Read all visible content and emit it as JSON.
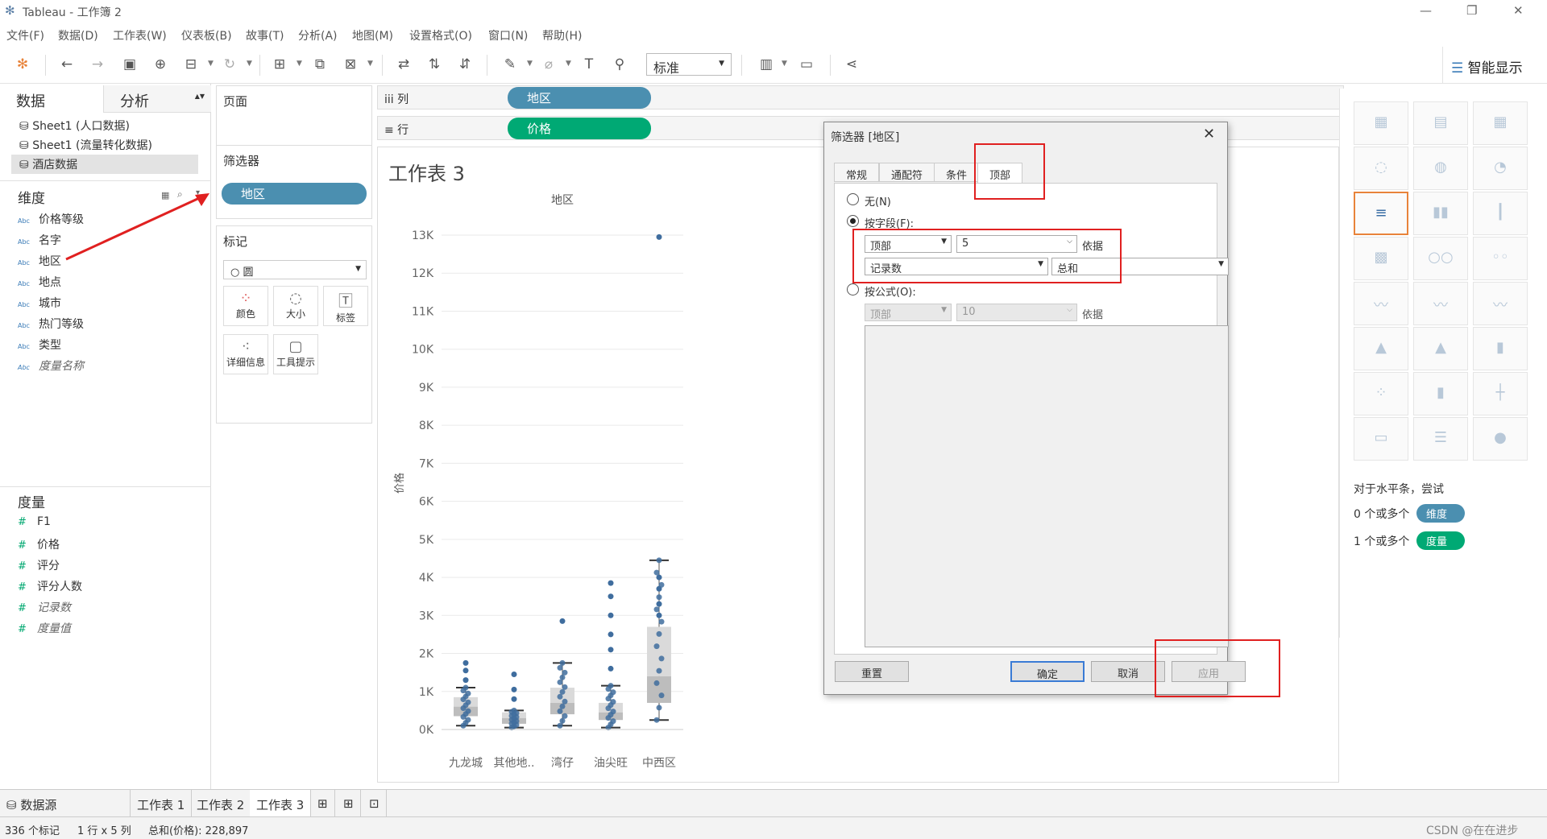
{
  "window": {
    "title": "Tableau - 工作簿 2",
    "controls": [
      "—",
      "❐",
      "✕"
    ]
  },
  "menu": [
    "文件(F)",
    "数据(D)",
    "工作表(W)",
    "仪表板(B)",
    "故事(T)",
    "分析(A)",
    "地图(M)",
    "设置格式(O)",
    "窗口(N)",
    "帮助(H)"
  ],
  "toolbar": {
    "fit_select": "标准",
    "smart_show": "智能显示"
  },
  "data_pane": {
    "tab_data": "数据",
    "tab_analysis": "分析",
    "datasources": [
      "Sheet1 (人口数据)",
      "Sheet1 (流量转化数据)",
      "酒店数据"
    ],
    "dimensions_title": "维度",
    "dimensions": [
      "价格等级",
      "名字",
      "地区",
      "地点",
      "城市",
      "热门等级",
      "类型",
      "度量名称"
    ],
    "measures_title": "度量",
    "measures": [
      "F1",
      "价格",
      "评分",
      "评分人数",
      "记录数",
      "度量值"
    ],
    "abc": "Abc",
    "hash": "#"
  },
  "shelves": {
    "pages": "页面",
    "filters": "筛选器",
    "filter_pill": "地区",
    "marks": "标记",
    "mark_type": "○ 圆",
    "mark_buttons": [
      "颜色",
      "大小",
      "标签",
      "详细信息",
      "工具提示"
    ],
    "columns_label": "iii  列",
    "rows_label": "≡  行",
    "columns_pill": "地区",
    "rows_pill": "价格"
  },
  "worksheet": {
    "title": "工作表 3"
  },
  "chart_data": {
    "type": "boxplot-scatter",
    "title": "地区",
    "xlabel": "",
    "ylabel": "价格",
    "categories": [
      "九龙城",
      "其他地..",
      "湾仔",
      "油尖旺",
      "中西区"
    ],
    "y_ticks": [
      "0K",
      "1K",
      "2K",
      "3K",
      "4K",
      "5K",
      "6K",
      "7K",
      "8K",
      "9K",
      "10K",
      "11K",
      "12K",
      "13K"
    ],
    "ylim": [
      0,
      13000
    ],
    "boxes": [
      {
        "min": 100,
        "q1": 350,
        "median": 600,
        "q3": 850,
        "max": 1100
      },
      {
        "min": 50,
        "q1": 150,
        "median": 300,
        "q3": 450,
        "max": 500
      },
      {
        "min": 100,
        "q1": 400,
        "median": 700,
        "q3": 1100,
        "max": 1750
      },
      {
        "min": 50,
        "q1": 250,
        "median": 450,
        "q3": 700,
        "max": 1150
      },
      {
        "min": 250,
        "q1": 700,
        "median": 1400,
        "q3": 2700,
        "max": 4450
      }
    ],
    "outliers": [
      [
        1300,
        1550,
        1750
      ],
      [
        800,
        1050,
        1450
      ],
      [
        2850
      ],
      [
        1600,
        2100,
        2500,
        3000,
        3500,
        3850
      ],
      [
        3000,
        3300,
        3700,
        4000,
        12950
      ]
    ],
    "grid": true
  },
  "dialog": {
    "title": "筛选器 [地区]",
    "tabs": [
      "常规",
      "通配符",
      "条件",
      "顶部"
    ],
    "opt_none": "无(N)",
    "opt_field": "按字段(F):",
    "top_select": "顶部",
    "top_n": "5",
    "by": "依据",
    "field_select": "记录数",
    "agg_select": "总和",
    "opt_formula": "按公式(O):",
    "formula_top": "顶部",
    "formula_n": "10",
    "formula_by": "依据",
    "reset": "重置",
    "ok": "确定",
    "cancel": "取消",
    "apply": "应用"
  },
  "smart_show": {
    "hint": "对于水平条，尝试",
    "dim_req": "0 个或多个",
    "dim_pill": "维度",
    "meas_req": "1 个或多个",
    "meas_pill": "度量"
  },
  "sheet_tabs": {
    "datasource": "数据源",
    "tabs": [
      "工作表 1",
      "工作表 2",
      "工作表 3"
    ]
  },
  "status": {
    "marks": "336 个标记",
    "layout": "1 行 x 5 列",
    "sum": "总和(价格): 228,897"
  },
  "watermark": "CSDN @在在进步",
  "colors": {
    "dim_pill": "#4b8fb0",
    "meas_pill": "#00a974",
    "highlight": "#e02020",
    "points": "#3f6d9e"
  }
}
